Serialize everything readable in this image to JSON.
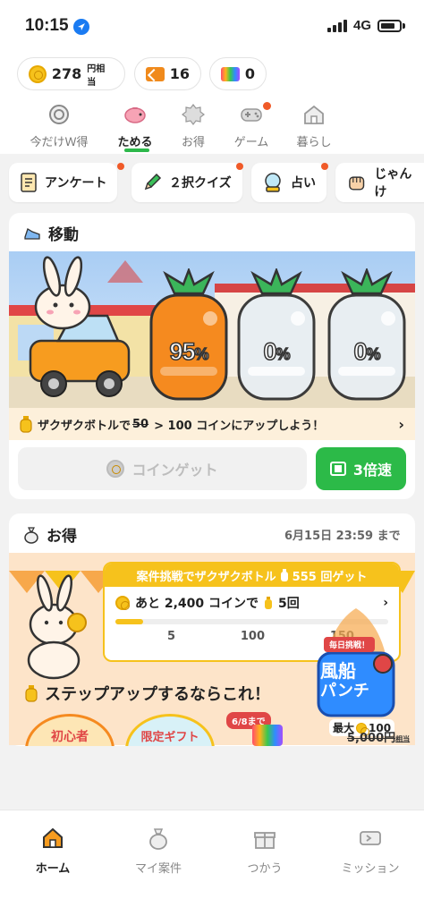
{
  "status_bar": {
    "time": "10:15",
    "network": "4G"
  },
  "balances": {
    "coins": "278",
    "coins_suffix": "円相当",
    "tickets": "16",
    "rainbow_tickets": "0"
  },
  "top_tabs": [
    {
      "label": "今だけＷ得",
      "icon": "coin-clock-icon",
      "active": false
    },
    {
      "label": "ためる",
      "icon": "piggy-bank-icon",
      "active": true
    },
    {
      "label": "お得",
      "icon": "badge-icon",
      "active": false
    },
    {
      "label": "ゲーム",
      "icon": "gamepad-icon",
      "active": false
    },
    {
      "label": "暮らし",
      "icon": "house-icon",
      "active": false
    }
  ],
  "chips": [
    {
      "label": "アンケート",
      "icon": "survey-icon"
    },
    {
      "label": "２択クイズ",
      "icon": "pencil-icon"
    },
    {
      "label": "占い",
      "icon": "crystal-ball-icon"
    },
    {
      "label": "じゃんけ",
      "icon": "fist-icon"
    }
  ],
  "move_card": {
    "title": "移動",
    "progress": [
      {
        "value": "95",
        "unit": "%"
      },
      {
        "value": "0",
        "unit": "%"
      },
      {
        "value": "0",
        "unit": "%"
      }
    ],
    "promo_prefix": "ザクザクボトルで",
    "promo_old": "50",
    "promo_new": "> 100 コインにアップしよう！",
    "coin_button": "コインゲット",
    "speed_button": "3倍速"
  },
  "deal_card": {
    "title": "お得",
    "deadline": "6月15日 23:59 まで",
    "mission_head_a": "案件挑戦でザクザクボトル",
    "mission_head_b": "555 回ゲット",
    "mission_row_a": "あと 2,400 コインで",
    "mission_row_b": "5回",
    "progress_fraction": 0.1,
    "milestones": [
      "5",
      "100",
      "150"
    ],
    "balloon_tag": "毎日挑戦！",
    "balloon_title_1": "風船",
    "balloon_title_2": "パンチ",
    "balloon_max": "最大",
    "balloon_max_value": "100",
    "stepup_title": "ステップアップするならこれ！",
    "stepup_items": [
      "初心者",
      "限定ギフト"
    ],
    "badge_date": "6/8まで",
    "price_strike": "5,000円",
    "price_suffix": "相当"
  },
  "bottom_nav": [
    {
      "label": "ホーム",
      "icon": "home-icon",
      "active": true
    },
    {
      "label": "マイ案件",
      "icon": "money-bag-icon",
      "active": false
    },
    {
      "label": "つかう",
      "icon": "gift-icon",
      "active": false
    },
    {
      "label": "ミッション",
      "icon": "ticket-icon",
      "active": false
    }
  ],
  "colors": {
    "accent_green": "#2cba48",
    "coin_yellow": "#f6c21c",
    "carrot_orange": "#f58a1f",
    "notification": "#f05a28"
  }
}
